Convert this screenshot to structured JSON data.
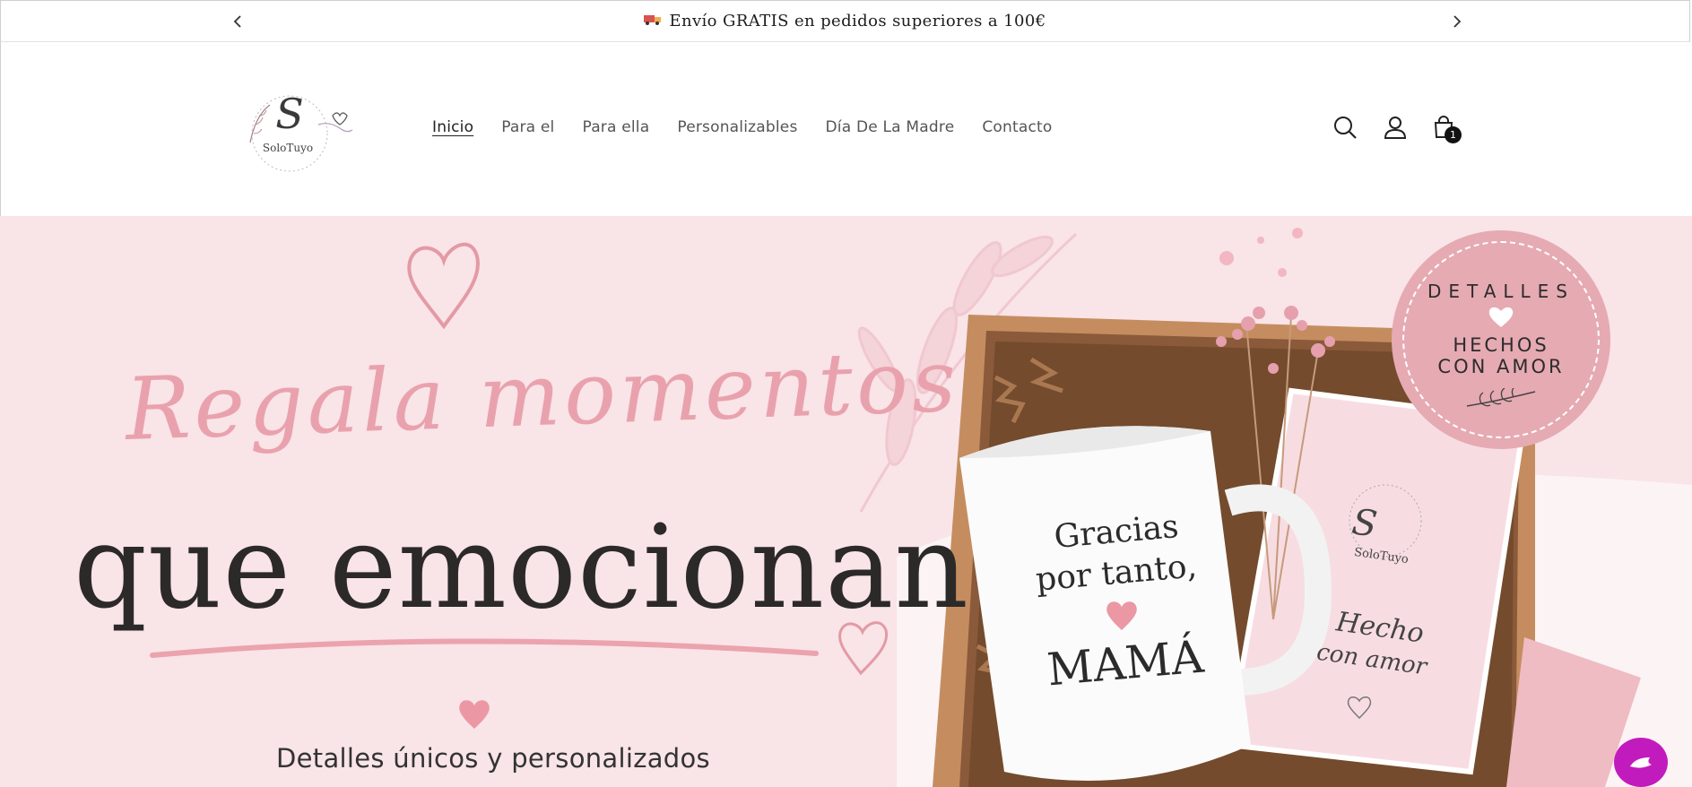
{
  "announcement": {
    "message": "Envío GRATIS en pedidos superiores a 100€",
    "prev_icon": "chevron-left-icon",
    "next_icon": "chevron-right-icon"
  },
  "header": {
    "logo_text": "SoloTuyo",
    "logo_initial": "S",
    "nav": [
      {
        "label": "Inicio"
      },
      {
        "label": "Para el"
      },
      {
        "label": "Para ella"
      },
      {
        "label": "Personalizables"
      },
      {
        "label": "Día De La Madre"
      },
      {
        "label": "Contacto"
      }
    ],
    "icons": [
      "search-icon",
      "account-icon",
      "cart-icon"
    ],
    "cart_count": "1"
  },
  "hero": {
    "script_line": "Regala momentos",
    "headline": "que emocionan",
    "subtitle": "Detalles únicos y personalizados",
    "badge": {
      "top": "DETALLES",
      "line1": "HECHOS",
      "line2": "CON AMOR"
    },
    "mug": {
      "line1": "Gracias",
      "line2": "por tanto,",
      "line3": "MAMÁ"
    },
    "card": {
      "brand": "SoloTuyo",
      "line1": "Hecho",
      "line2": "con amor"
    },
    "colors": {
      "background": "#f9e4e8",
      "accent_pink": "#e9a2ad",
      "chat": "#c21bbd"
    }
  }
}
